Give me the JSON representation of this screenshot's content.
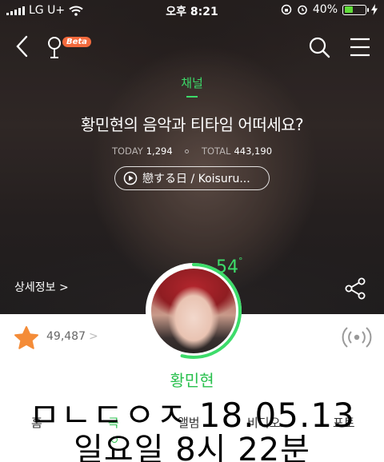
{
  "status_bar": {
    "carrier": "LG U+",
    "time": "오후 8:21",
    "battery": "40%",
    "battery_level": 0.4
  },
  "nav": {
    "beta_badge": "Beta"
  },
  "channel": {
    "label": "채널",
    "title": "황민현의 음악과 티타임 어떠세요?",
    "today_label": "TODAY",
    "today_value": "1,294",
    "total_label": "TOTAL",
    "total_value": "443,190",
    "now_playing": "戀する日 / Koisuru...",
    "detail_link": "상세정보 >"
  },
  "profile": {
    "percent_value": 54,
    "percent_text": "54",
    "degree_symbol": "°",
    "like_count": "49,487",
    "like_chevron": ">",
    "artist_name": "황민현"
  },
  "tabs": {
    "home": "홈",
    "song": "곡",
    "album": "앨범",
    "video": "비디오",
    "photo": "포토",
    "active": "song"
  },
  "caption": {
    "line1": "ㅁㄴㄷㅇㅈ 18.05.13",
    "line2": "일요일 8시 22분"
  },
  "colors": {
    "accent_green": "#28c04d",
    "beta_orange": "#f36a3d",
    "star_orange": "#f48c38"
  },
  "icons": [
    "back-icon",
    "mic-icon",
    "search-icon",
    "menu-icon",
    "play-icon",
    "share-icon",
    "star-icon",
    "radio-icon"
  ]
}
